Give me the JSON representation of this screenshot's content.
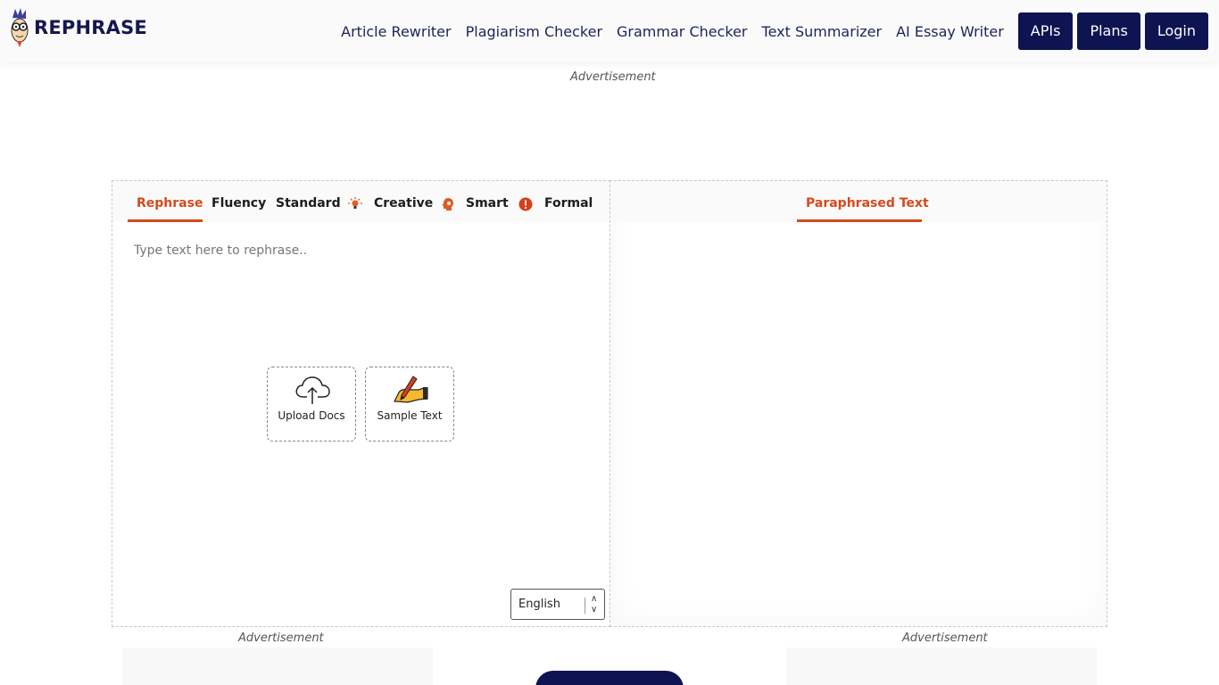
{
  "brand": {
    "name": "REPHRASE"
  },
  "nav": {
    "links": [
      "Article Rewriter",
      "Plagiarism Checker",
      "Grammar Checker",
      "Text Summarizer",
      "AI Essay Writer"
    ],
    "buttons": [
      "APIs",
      "Plans",
      "Login"
    ]
  },
  "ads": {
    "top": "Advertisement",
    "left": "Advertisement",
    "right": "Advertisement"
  },
  "editor": {
    "tabs": [
      {
        "label": "Rephrase",
        "icon": ""
      },
      {
        "label": "Fluency",
        "icon": ""
      },
      {
        "label": "Standard",
        "icon": ""
      },
      {
        "label": "Creative",
        "icon": "lightbulb-icon"
      },
      {
        "label": "Smart",
        "icon": "brain-head-icon"
      },
      {
        "label": "Formal",
        "icon": "exclamation-circle-icon"
      }
    ],
    "active_tab": "Rephrase",
    "placeholder": "Type text here to rephrase..",
    "upload_label": "Upload Docs",
    "sample_label": "Sample Text",
    "language": "English"
  },
  "output": {
    "tab_label": "Paraphrased Text"
  },
  "colors": {
    "accent": "#d44a1c",
    "navy": "#0e1452"
  }
}
